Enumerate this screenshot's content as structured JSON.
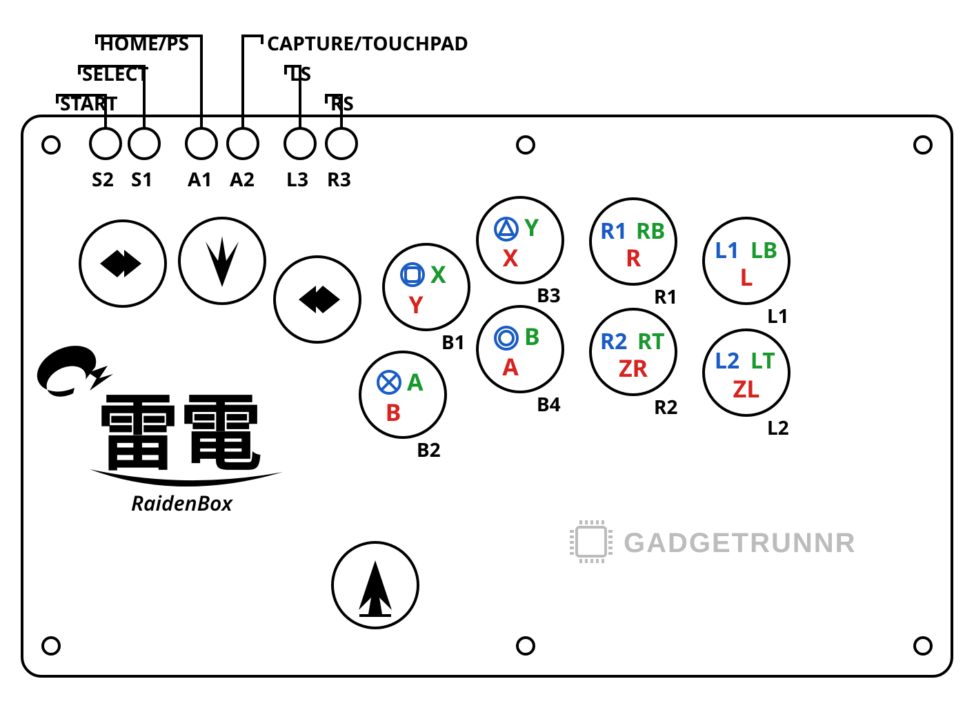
{
  "leads": {
    "start": "START",
    "select": "SELECT",
    "home_ps": "HOME/PS",
    "capture_touchpad": "CAPTURE/TOUCHPAD",
    "ls": "LS",
    "rs": "RS"
  },
  "small_row": {
    "s2": "S2",
    "s1": "S1",
    "a1": "A1",
    "a2": "A2",
    "l3": "L3",
    "r3": "R3"
  },
  "action_labels": {
    "b1": "B1",
    "b2": "B2",
    "b3": "B3",
    "b4": "B4",
    "r1": "R1",
    "r2": "R2",
    "l1": "L1",
    "l2": "L2"
  },
  "buttons": {
    "b1": {
      "ps": "□",
      "xbox": "X",
      "sw": "Y"
    },
    "b2": {
      "ps": "✕",
      "xbox": "A",
      "sw": "B"
    },
    "b3": {
      "ps": "△",
      "xbox": "Y",
      "sw": "X"
    },
    "b4": {
      "ps": "○",
      "xbox": "B",
      "sw": "A"
    },
    "r1": {
      "ps": "R1",
      "xbox": "RB",
      "sw": "R"
    },
    "r2": {
      "ps": "R2",
      "xbox": "RT",
      "sw": "ZR"
    },
    "l1": {
      "ps": "L1",
      "xbox": "LB",
      "sw": "L"
    },
    "l2": {
      "ps": "L2",
      "xbox": "LT",
      "sw": "ZL"
    }
  },
  "logo": {
    "kanji": "雷電",
    "roman": "RaidenBox"
  },
  "brand": "GADGETRUNNR"
}
